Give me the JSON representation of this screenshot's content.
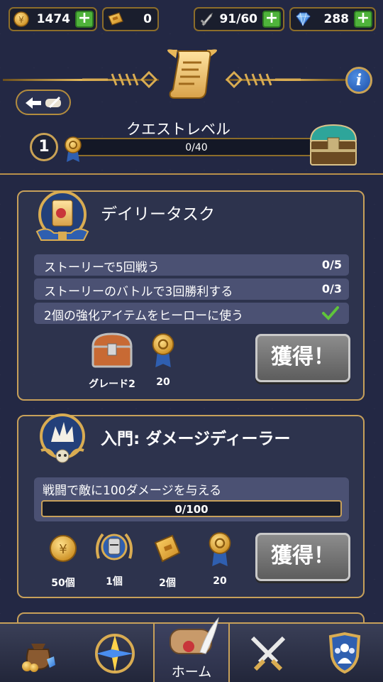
{
  "currencies": {
    "gold": {
      "value": "1474",
      "icon": "gold-coin-icon"
    },
    "tickets": {
      "value": "0",
      "icon": "ticket-icon"
    },
    "energy": {
      "value": "91/60",
      "icon": "energy-sword-icon"
    },
    "gems": {
      "value": "288",
      "icon": "gem-icon"
    },
    "plus": "+"
  },
  "quest": {
    "title": "クエストレベル",
    "level": "1",
    "progress_text": "0/40",
    "progress_fraction": 0
  },
  "info_label": "i",
  "daily": {
    "title": "デイリータスク",
    "tasks": [
      {
        "label": "ストーリーで5回戦う",
        "progress": "0/5"
      },
      {
        "label": "ストーリーのバトルで3回勝利する",
        "progress": "0/3"
      },
      {
        "label": "2個の強化アイテムをヒーローに使う",
        "progress": ""
      }
    ],
    "rewards": [
      {
        "icon": "treasure-chest-icon",
        "label": "グレード2"
      },
      {
        "icon": "quest-medal-icon",
        "label": "20"
      }
    ],
    "claim": "獲得！"
  },
  "intro": {
    "title": "入門: ダメージディーラー",
    "objective": "戦闘で敵に100ダメージを与える",
    "progress_text": "0/100",
    "progress_fraction": 0,
    "rewards": [
      {
        "icon": "gold-coin-icon",
        "label": "50個"
      },
      {
        "icon": "knight-helmet-icon",
        "label": "1個"
      },
      {
        "icon": "ticket-icon",
        "label": "2個"
      },
      {
        "icon": "quest-medal-icon",
        "label": "20"
      }
    ],
    "claim": "獲得！"
  },
  "nav": {
    "items": [
      {
        "icon": "loot-bag-icon",
        "label": ""
      },
      {
        "icon": "crystal-emblem-icon",
        "label": ""
      },
      {
        "icon": "scroll-quill-icon",
        "label": "ホーム"
      },
      {
        "icon": "crossed-swords-icon",
        "label": ""
      },
      {
        "icon": "guild-shield-icon",
        "label": ""
      }
    ]
  },
  "colors": {
    "gold_border": "#c7a05a",
    "plus_green": "#4fb33b",
    "check_green": "#5fc43a",
    "panel_bg": "#2f344e",
    "background": "#232844"
  }
}
